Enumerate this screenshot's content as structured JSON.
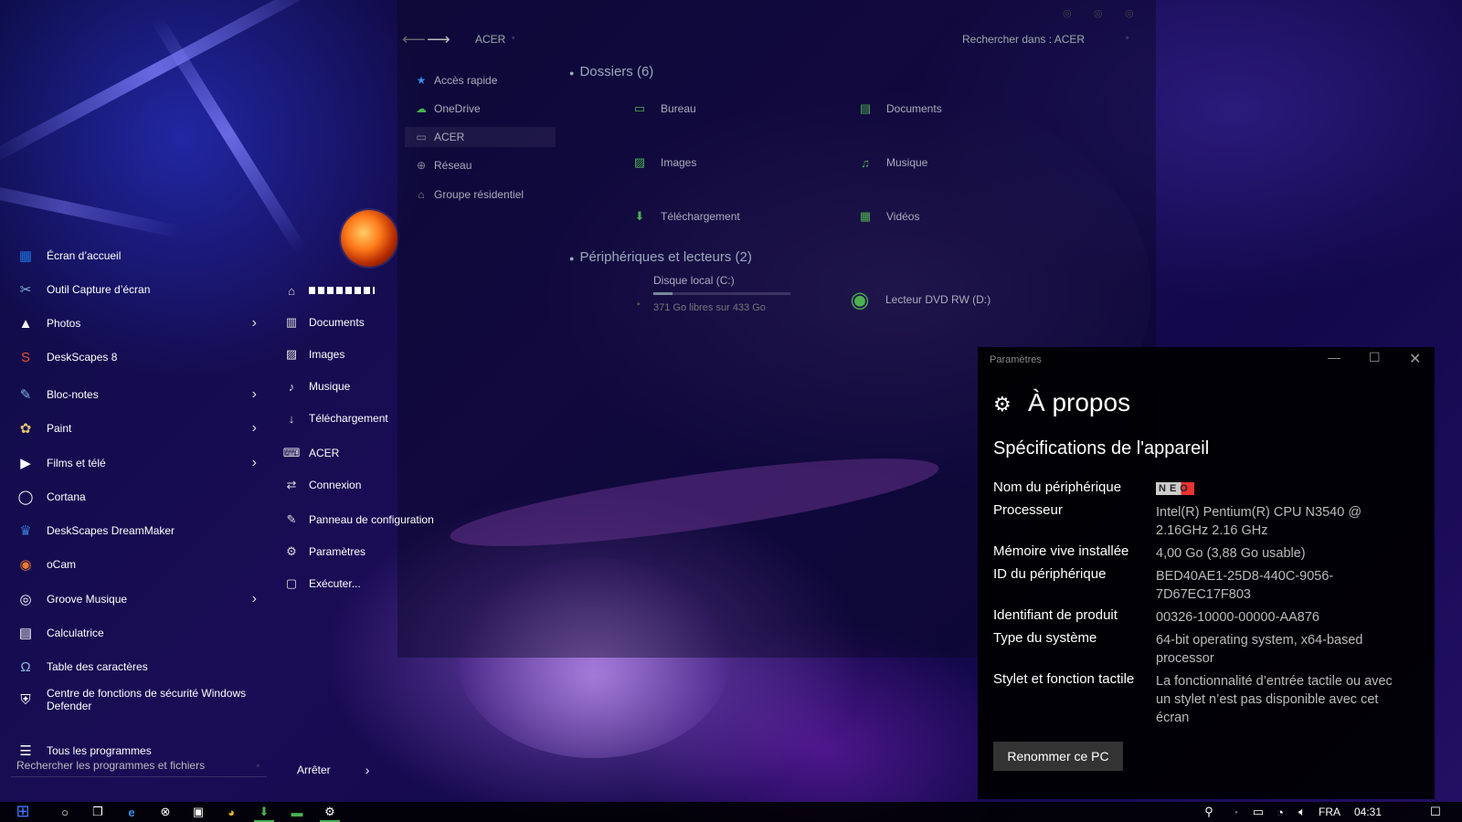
{
  "start_menu": {
    "apps": [
      {
        "label": "Écran d’accueil",
        "icon": "home-screen-icon",
        "color": "#1e6fd9",
        "has_arrow": false
      },
      {
        "label": "Outil Capture d’écran",
        "icon": "snipping-tool-icon",
        "color": "#8ab4d8",
        "has_arrow": false
      },
      {
        "label": "Photos",
        "icon": "photos-icon",
        "color": "#ffffff",
        "has_arrow": true
      },
      {
        "label": "DeskScapes 8",
        "icon": "deskscapes-icon",
        "color": "#e8532b",
        "has_arrow": false
      },
      {
        "label": "Bloc-notes",
        "icon": "notepad-icon",
        "color": "#7fb2e0",
        "has_arrow": true
      },
      {
        "label": "Paint",
        "icon": "paint-icon",
        "color": "#e0c070",
        "has_arrow": true
      },
      {
        "label": "Films et télé",
        "icon": "films-icon",
        "color": "#ffffff",
        "has_arrow": true
      },
      {
        "label": "Cortana",
        "icon": "cortana-icon",
        "color": "#ffffff",
        "has_arrow": false
      },
      {
        "label": "DeskScapes DreamMaker",
        "icon": "dreammaker-icon",
        "color": "#3a78d0",
        "has_arrow": false
      },
      {
        "label": "oCam",
        "icon": "ocam-icon",
        "color": "#e87a2b",
        "has_arrow": false
      },
      {
        "label": "Groove Musique",
        "icon": "groove-icon",
        "color": "#ffffff",
        "has_arrow": true
      },
      {
        "label": "Calculatrice",
        "icon": "calculator-icon",
        "color": "#ffffff",
        "has_arrow": false
      },
      {
        "label": "Table des caractères",
        "icon": "charmap-icon",
        "color": "#8ab4d8",
        "has_arrow": false
      },
      {
        "label": "Centre de fonctions de sécurité Windows Defender",
        "icon": "shield-icon",
        "color": "#ffffff",
        "has_arrow": false
      }
    ],
    "all_programs": "Tous les programmes",
    "search_placeholder": "Rechercher les programmes et fichiers",
    "places": [
      {
        "label": "Documents",
        "icon": "documents-icon"
      },
      {
        "label": "Images",
        "icon": "images-icon"
      },
      {
        "label": "Musique",
        "icon": "music-icon"
      },
      {
        "label": "Téléchargement",
        "icon": "download-icon"
      },
      {
        "label": "ACER",
        "icon": "laptop-icon"
      },
      {
        "label": "Connexion",
        "icon": "connection-icon"
      },
      {
        "label": "Panneau de configuration",
        "icon": "wrench-icon"
      },
      {
        "label": "Paramètres",
        "icon": "gear-icon"
      },
      {
        "label": "Exécuter...",
        "icon": "run-icon"
      }
    ],
    "power_label": "Arrêter"
  },
  "explorer": {
    "location": "ACER",
    "search_placeholder": "Rechercher dans : ACER",
    "nav": [
      {
        "label": "Accès rapide",
        "icon": "star-icon"
      },
      {
        "label": "OneDrive",
        "icon": "cloud-icon"
      },
      {
        "label": "ACER",
        "icon": "monitor-icon"
      },
      {
        "label": "Réseau",
        "icon": "network-icon"
      },
      {
        "label": "Groupe résidentiel",
        "icon": "homegroup-icon"
      }
    ],
    "folders_header": "Dossiers (6)",
    "folders": [
      {
        "label": "Bureau",
        "icon": "desktop-folder-icon"
      },
      {
        "label": "Documents",
        "icon": "document-folder-icon"
      },
      {
        "label": "Images",
        "icon": "image-folder-icon"
      },
      {
        "label": "Musique",
        "icon": "music-folder-icon"
      },
      {
        "label": "Téléchargement",
        "icon": "download-folder-icon"
      },
      {
        "label": "Vidéos",
        "icon": "video-folder-icon"
      }
    ],
    "devices_header": "Périphériques et lecteurs (2)",
    "drive_c": {
      "label": "Disque local (C:)",
      "free": "371 Go libres sur 433 Go",
      "used_fraction": 0.14
    },
    "drive_d": {
      "label": "Lecteur DVD RW (D:)"
    }
  },
  "settings": {
    "window_title": "Paramètres",
    "page_title": "À propos",
    "section_title": "Spécifications de l'appareil",
    "specs": [
      {
        "label": "Nom du périphérique",
        "value": "NEO"
      },
      {
        "label": "Processeur",
        "value": "Intel(R) Pentium(R) CPU  N3540  @ 2.16GHz   2.16 GHz"
      },
      {
        "label": "Mémoire vive installée",
        "value": "4,00 Go (3,88 Go usable)"
      },
      {
        "label": "ID du périphérique",
        "value": "BED40AE1-25D8-440C-9056-7D67EC17F803"
      },
      {
        "label": "Identifiant de produit",
        "value": "00326-10000-00000-AA876"
      },
      {
        "label": "Type du système",
        "value": "64-bit operating system, x64-based processor"
      },
      {
        "label": "Stylet et fonction tactile",
        "value": "La fonctionnalité d’entrée tactile ou avec un stylet n’est pas disponible avec cet écran"
      }
    ],
    "rename_button": "Renommer ce PC"
  },
  "taskbar": {
    "language": "FRA",
    "time": "04:31"
  }
}
